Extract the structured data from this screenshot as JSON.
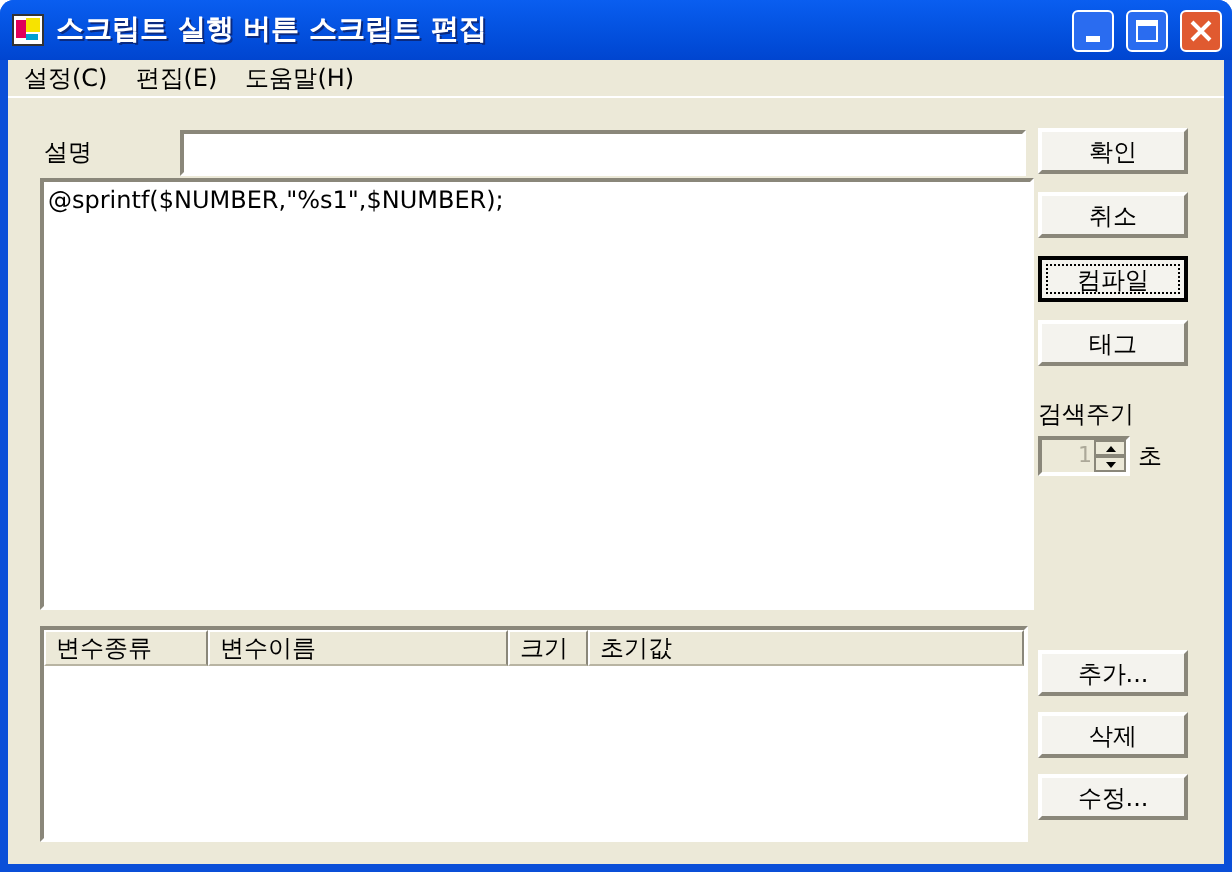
{
  "window": {
    "title": "스크립트 실행 버튼 스크립트 편집"
  },
  "menu": [
    "설정(C)",
    "편집(E)",
    "도움말(H)"
  ],
  "description": {
    "label": "설명"
  },
  "script": {
    "value": "@sprintf($NUMBER,\"%s1\",$NUMBER);"
  },
  "side_buttons": [
    {
      "label": "확인",
      "focused": false
    },
    {
      "label": "취소",
      "focused": false
    },
    {
      "label": "컴파일",
      "focused": true
    },
    {
      "label": "태그",
      "focused": false
    }
  ],
  "interval": {
    "label": "검색주기",
    "value": "1",
    "unit": "초",
    "disabled": true
  },
  "variables": {
    "columns": [
      "변수종류",
      "변수이름",
      "크기",
      "초기값"
    ]
  },
  "list_buttons": [
    "추가...",
    "삭제",
    "수정..."
  ]
}
